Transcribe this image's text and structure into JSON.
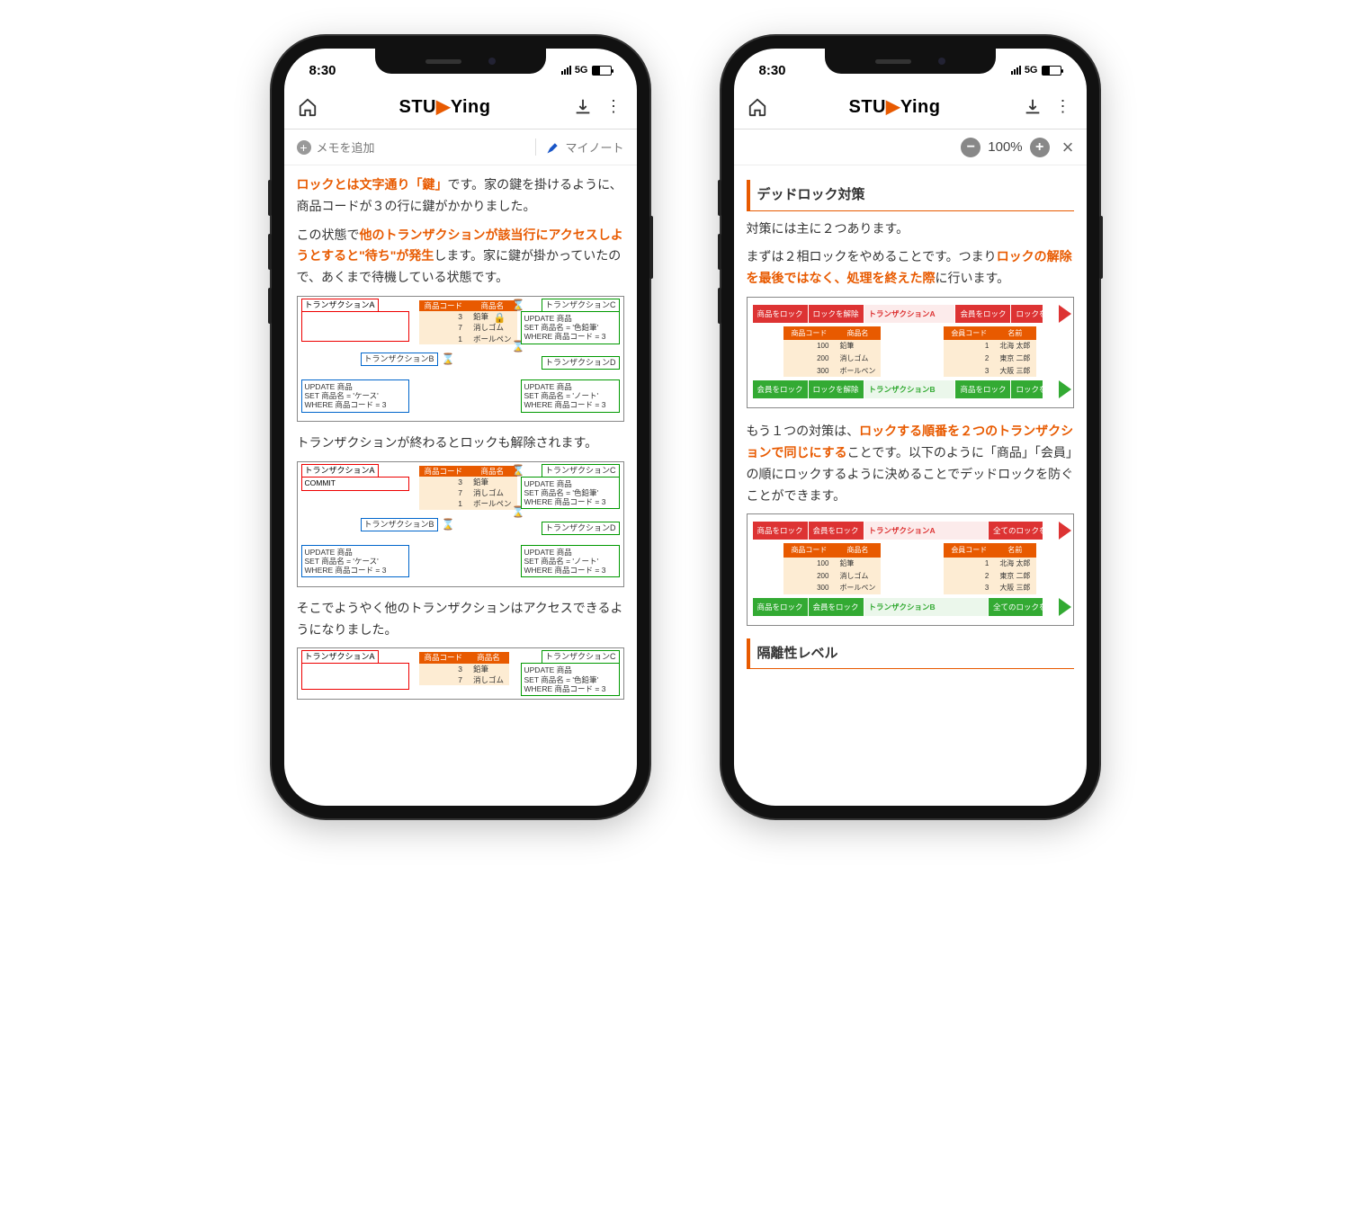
{
  "status": {
    "time": "8:30",
    "net": "5G"
  },
  "header": {
    "brand_a": "STU",
    "brand_b": "Ying",
    "memo": "メモを追加",
    "mynote": "マイノート",
    "zoom": "100%"
  },
  "left": {
    "p1a": "ロックとは文字通り「鍵」",
    "p1b": "です。家の鍵を掛けるように、商品コードが３の行に鍵がかかりました。",
    "p2a": "この状態で",
    "p2b": "他のトランザクションが該当行にアクセスしようとすると\"待ち\"が発生",
    "p2c": "します。家に鍵が掛かっていたので、あくまで待機している状態です。",
    "p3": "トランザクションが終わるとロックも解除されます。",
    "p4": "そこでようやく他のトランザクションはアクセスできるようになりました。",
    "table": {
      "h1": "商品コード",
      "h2": "商品名",
      "r": [
        [
          "3",
          "鉛筆"
        ],
        [
          "7",
          "消しゴム"
        ],
        [
          "1",
          "ボールペン"
        ]
      ]
    },
    "tx": {
      "a": "トランザクションA",
      "b": "トランザクションB",
      "c": "トランザクションC",
      "d": "トランザクションD",
      "commit": "COMMIT",
      "sql_c": "UPDATE 商品\nSET 商品名 = '色鉛筆'\nWHERE 商品コード = 3",
      "sql_b": "UPDATE 商品\nSET 商品名 = 'ケース'\nWHERE 商品コード = 3",
      "sql_d": "UPDATE 商品\nSET 商品名 = 'ノート'\nWHERE 商品コード = 3"
    }
  },
  "right": {
    "h1": "デッドロック対策",
    "p1": "対策には主に２つあります。",
    "p2a": "まずは２相ロックをやめることです。つまり",
    "p2b": "ロックの解除を最後ではなく、処理を終えた際",
    "p2c": "に行います。",
    "p3a": "もう１つの対策は、",
    "p3b": "ロックする順番を２つのトランザクションで同じにする",
    "p3c": "ことです。以下のように「商品」「会員」の順にロックするように決めることでデッドロックを防ぐことができます。",
    "h2": "隔離性レベル",
    "flow": {
      "lock_item": "商品をロック",
      "unlock": "ロックを解除",
      "lock_member": "会員をロック",
      "tnA": "トランザクションA",
      "tnB": "トランザクションB",
      "unlock_all": "全てのロックを解除"
    },
    "tblA": {
      "h1": "商品コード",
      "h2": "商品名",
      "r": [
        [
          "100",
          "鉛筆"
        ],
        [
          "200",
          "消しゴム"
        ],
        [
          "300",
          "ボールペン"
        ]
      ]
    },
    "tblB": {
      "h1": "会員コード",
      "h2": "名前",
      "r": [
        [
          "1",
          "北海 太郎"
        ],
        [
          "2",
          "東京 二郎"
        ],
        [
          "3",
          "大阪 三郎"
        ]
      ]
    }
  }
}
